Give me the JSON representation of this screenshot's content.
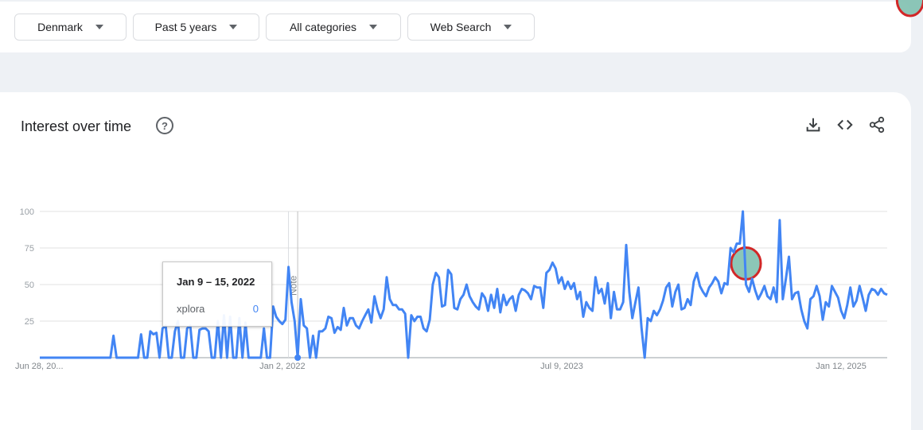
{
  "filters": {
    "region": "Denmark",
    "time_range": "Past 5 years",
    "category": "All categories",
    "property": "Web Search"
  },
  "card": {
    "title": "Interest over time",
    "help_icon": "help-circle-icon",
    "actions": [
      "download-icon",
      "embed-code-icon",
      "share-icon"
    ]
  },
  "tooltip": {
    "date": "Jan 9 – 15, 2022",
    "term": "xplora",
    "value": "0"
  },
  "chart_data": {
    "type": "line",
    "y_ticks": [
      "100",
      "75",
      "50",
      "25"
    ],
    "x_tick_labels": [
      "Jun 28, 20...",
      "Jan 2, 2022",
      "Jul 9, 2023",
      "Jan 12, 2025"
    ],
    "note_label": "Note",
    "ylim": [
      0,
      100
    ],
    "series": [
      {
        "name": "xplora",
        "color": "#4285f4",
        "values": [
          0,
          0,
          0,
          0,
          0,
          0,
          0,
          0,
          0,
          0,
          0,
          0,
          0,
          0,
          0,
          0,
          0,
          0,
          0,
          0,
          0,
          0,
          0,
          0,
          15,
          0,
          0,
          0,
          0,
          0,
          0,
          0,
          0,
          16,
          0,
          0,
          18,
          16,
          17,
          0,
          20,
          22,
          0,
          0,
          18,
          25,
          0,
          0,
          20,
          22,
          0,
          0,
          19,
          20,
          20,
          18,
          0,
          0,
          25,
          0,
          29,
          0,
          28,
          0,
          0,
          27,
          0,
          24,
          0,
          0,
          0,
          0,
          0,
          20,
          0,
          0,
          35,
          28,
          25,
          23,
          26,
          62,
          38,
          25,
          0,
          40,
          22,
          20,
          0,
          15,
          0,
          18,
          18,
          20,
          28,
          27,
          17,
          21,
          19,
          34,
          22,
          27,
          27,
          22,
          20,
          25,
          29,
          33,
          24,
          42,
          33,
          27,
          33,
          55,
          40,
          36,
          36,
          33,
          33,
          30,
          0,
          29,
          25,
          28,
          28,
          20,
          18,
          26,
          50,
          58,
          55,
          35,
          36,
          60,
          57,
          34,
          33,
          40,
          43,
          50,
          42,
          38,
          35,
          33,
          44,
          41,
          32,
          43,
          34,
          47,
          31,
          43,
          36,
          40,
          42,
          32,
          43,
          47,
          46,
          44,
          40,
          49,
          48,
          48,
          34,
          58,
          60,
          65,
          61,
          51,
          55,
          47,
          52,
          47,
          51,
          40,
          45,
          28,
          38,
          34,
          32,
          55,
          44,
          47,
          37,
          51,
          27,
          45,
          33,
          33,
          38,
          77,
          45,
          27,
          38,
          48,
          20,
          0,
          27,
          25,
          32,
          29,
          33,
          39,
          48,
          51,
          35,
          45,
          50,
          33,
          34,
          40,
          36,
          52,
          58,
          49,
          45,
          42,
          48,
          51,
          55,
          52,
          44,
          51,
          50,
          75,
          72,
          78,
          78,
          100,
          50,
          45,
          54,
          46,
          40,
          44,
          49,
          42,
          40,
          48,
          38,
          94,
          40,
          54,
          69,
          40,
          44,
          45,
          33,
          25,
          20,
          40,
          42,
          49,
          42,
          26,
          38,
          35,
          49,
          45,
          41,
          32,
          27,
          36,
          48,
          35,
          39,
          49,
          41,
          32,
          43,
          47,
          46,
          43,
          47,
          44,
          43
        ]
      }
    ],
    "hover_index": 84,
    "highlights": [
      {
        "from_index": 227,
        "to_index": 233
      },
      {
        "from_index": 281,
        "to_index": 286
      }
    ],
    "highlight_fill": "#86c3b4",
    "highlight_stroke": "#d01c1c"
  }
}
